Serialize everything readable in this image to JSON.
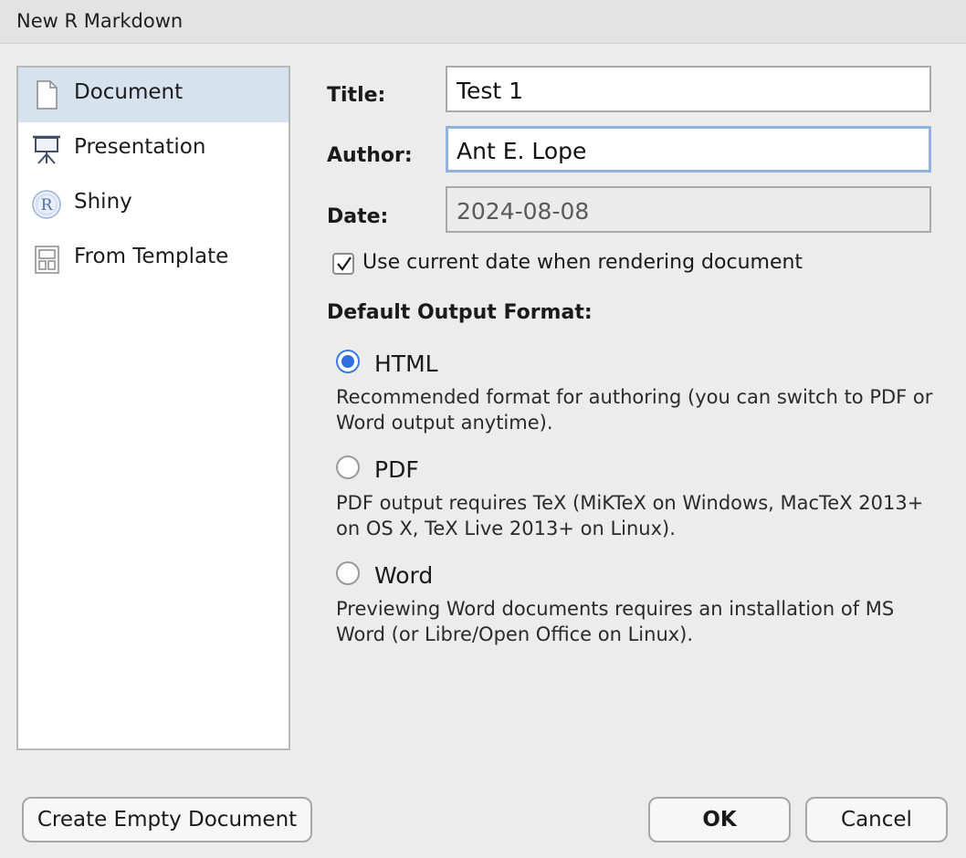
{
  "window": {
    "title": "New R Markdown"
  },
  "sidebar": {
    "items": [
      {
        "label": "Document",
        "icon": "document-icon",
        "selected": true
      },
      {
        "label": "Presentation",
        "icon": "presentation-easel-icon",
        "selected": false
      },
      {
        "label": "Shiny",
        "icon": "shiny-r-logo-icon",
        "selected": false
      },
      {
        "label": "From Template",
        "icon": "template-icon",
        "selected": false
      }
    ]
  },
  "form": {
    "title_label": "Title:",
    "title_value": "Test 1",
    "author_label": "Author:",
    "author_value": "Ant E. Lope",
    "date_label": "Date:",
    "date_value": "2024-08-08",
    "use_current_date_label": "Use current date when rendering document",
    "use_current_date_checked": true
  },
  "output": {
    "heading": "Default Output Format:",
    "options": [
      {
        "label": "HTML",
        "selected": true,
        "description": "Recommended format for authoring (you can switch to PDF or Word output anytime)."
      },
      {
        "label": "PDF",
        "selected": false,
        "description": "PDF output requires TeX (MiKTeX on Windows, MacTeX 2013+ on OS X, TeX Live 2013+ on Linux)."
      },
      {
        "label": "Word",
        "selected": false,
        "description": "Previewing Word documents requires an installation of MS Word (or Libre/Open Office on Linux)."
      }
    ]
  },
  "buttons": {
    "create_empty": "Create Empty Document",
    "ok": "OK",
    "cancel": "Cancel"
  },
  "colors": {
    "selection": "#d6e2ee",
    "radio_accent": "#2f6fe0",
    "focus_ring": "#8fb3dd"
  }
}
